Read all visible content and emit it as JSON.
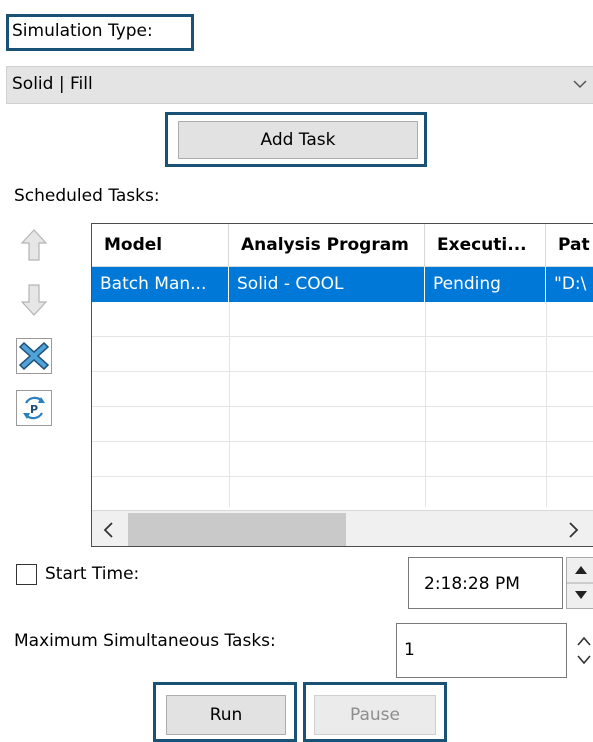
{
  "simulation": {
    "label": "Simulation Type:",
    "selected": "Solid | Fill",
    "chevron_icon": "chevron-down-icon"
  },
  "add_task": {
    "label": "Add Task"
  },
  "scheduled": {
    "label": "Scheduled Tasks:",
    "icons": [
      "arrow-up-icon",
      "arrow-down-icon",
      "delete-x-icon",
      "parameters-icon"
    ],
    "columns": [
      "Model",
      "Analysis Program",
      "Executi...",
      "Pat"
    ],
    "rows": [
      {
        "model": "Batch Man...",
        "program": "Solid - COOL",
        "execution": "Pending",
        "path": "\"D:\\"
      }
    ],
    "scroll_left_icon": "chevron-left-icon",
    "scroll_right_icon": "chevron-right-icon",
    "selected_color": "#0078d7"
  },
  "start_time": {
    "label": "Start Time:",
    "checked": false,
    "value": "2:18:28 PM"
  },
  "max_tasks": {
    "label": "Maximum Simultaneous Tasks:",
    "value": "1"
  },
  "buttons": {
    "run": "Run",
    "pause": "Pause"
  },
  "colors": {
    "highlight_outline": "#1a5276",
    "selection": "#0078d7"
  }
}
